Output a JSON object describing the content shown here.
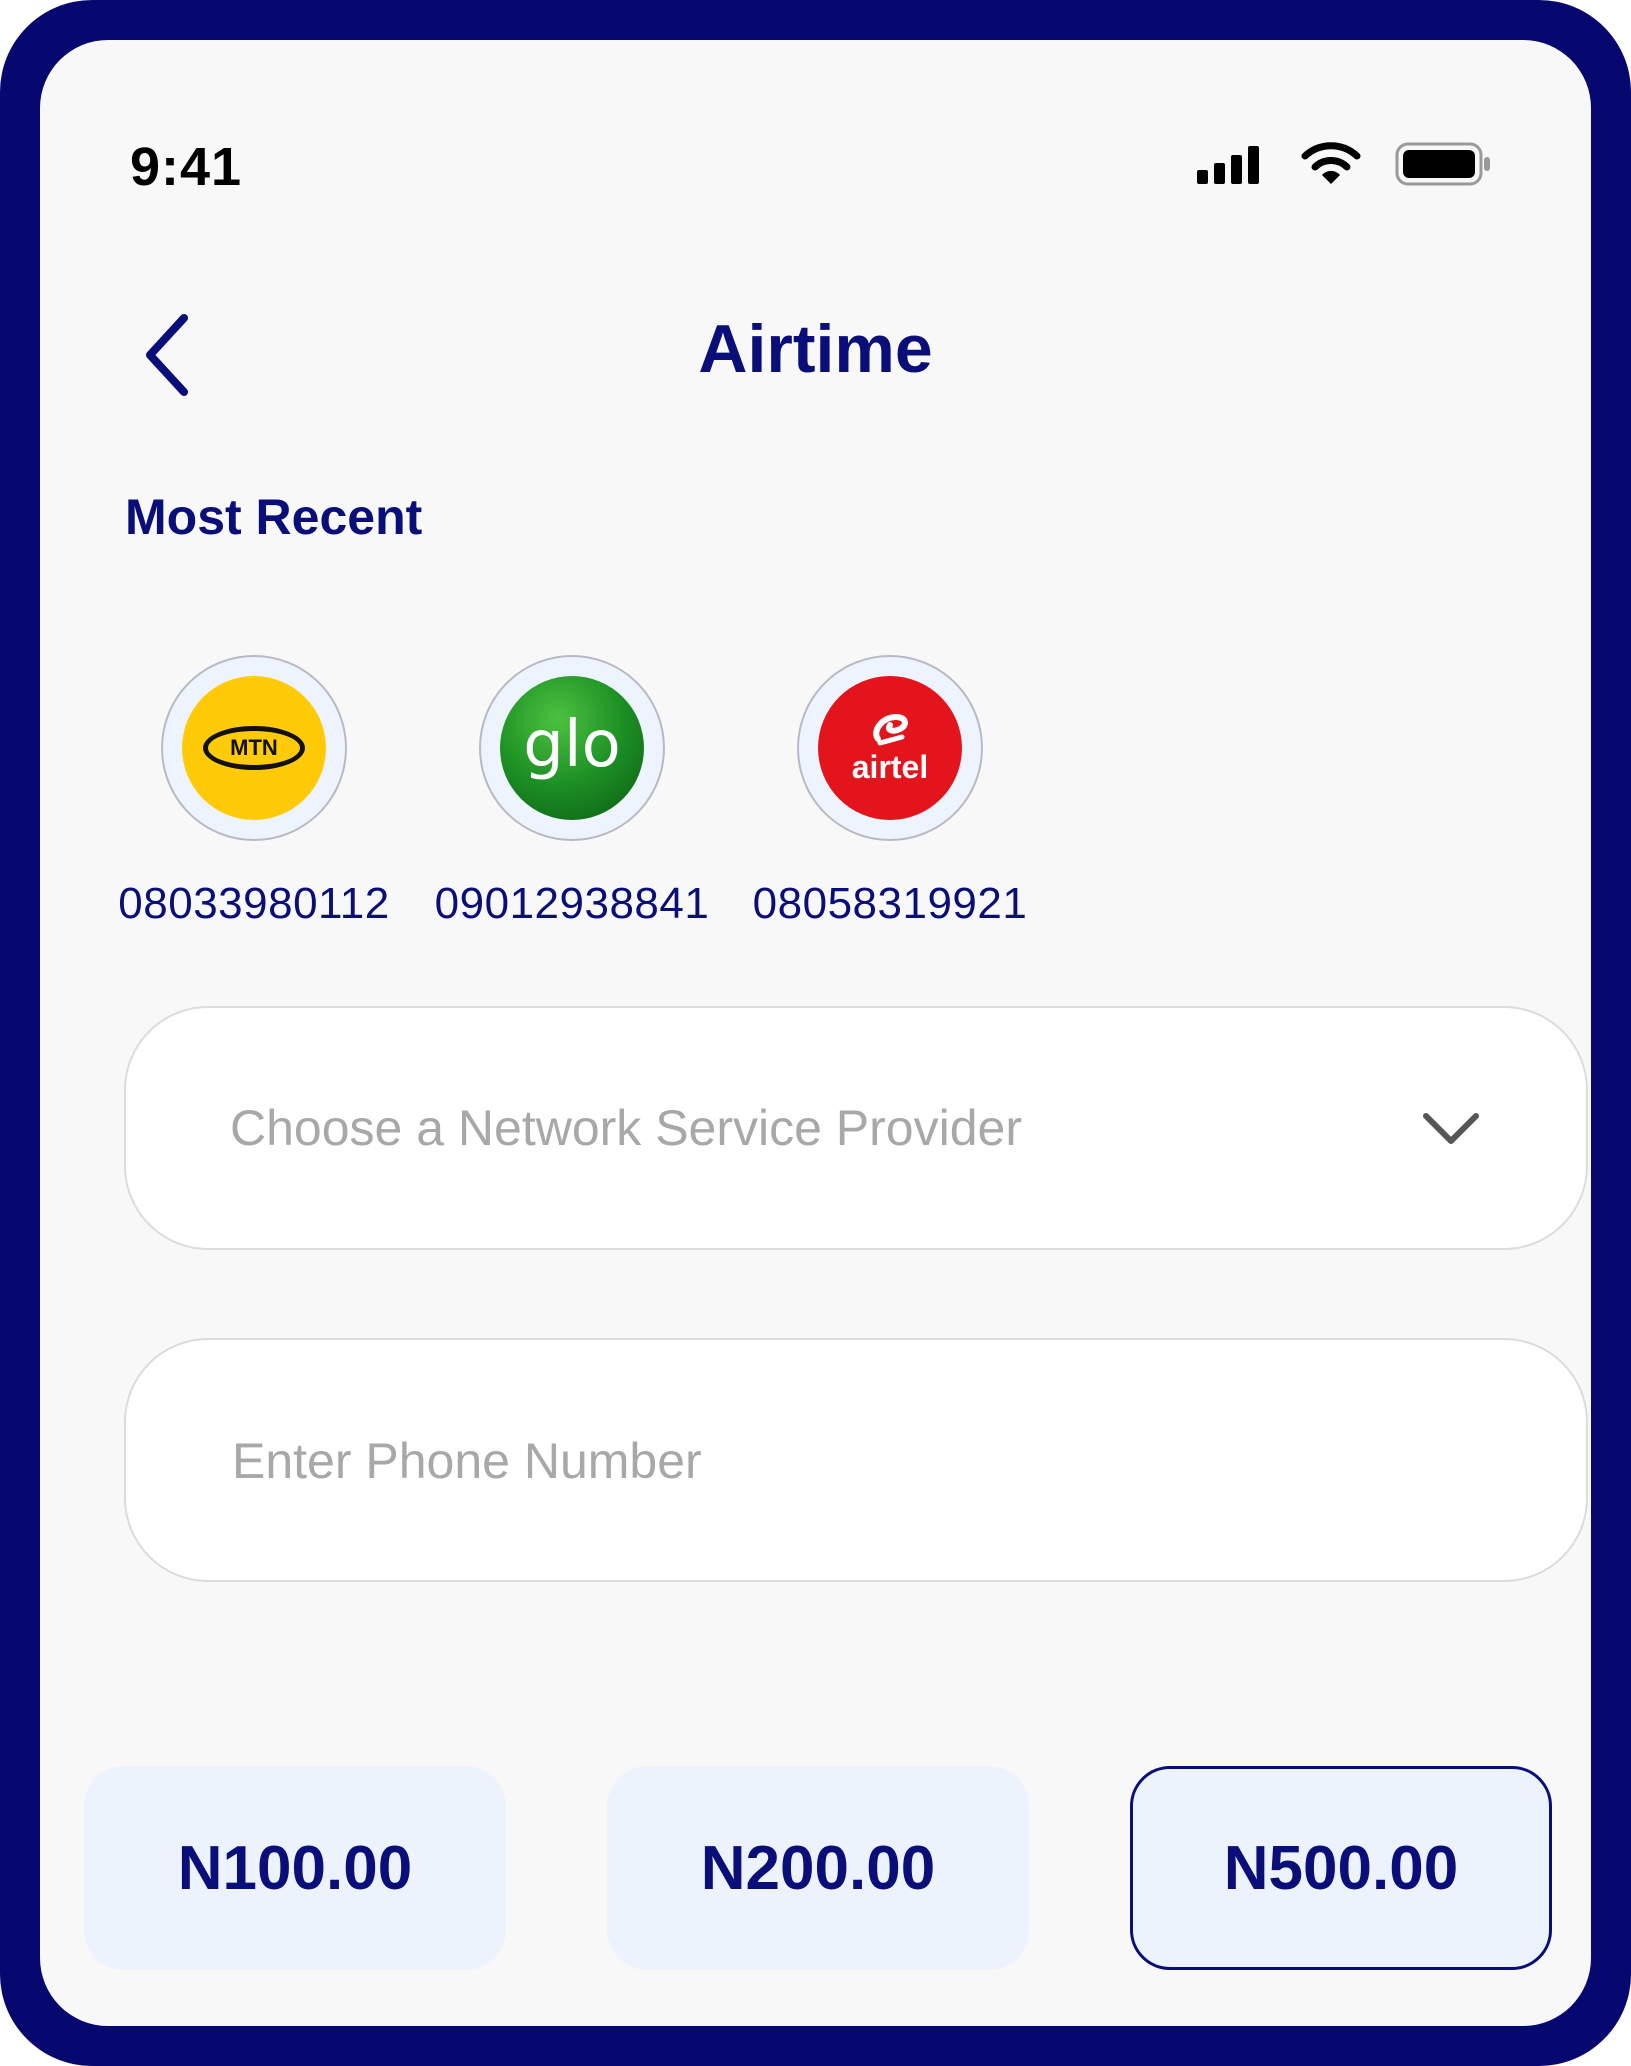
{
  "status_bar": {
    "time": "9:41",
    "icons": [
      "signal-icon",
      "wifi-icon",
      "battery-icon"
    ]
  },
  "header": {
    "title": "Airtime",
    "back_icon": "chevron-left-icon"
  },
  "recent": {
    "title": "Most Recent",
    "items": [
      {
        "network": "MTN",
        "logo_text": "MTN",
        "number": "08033980112"
      },
      {
        "network": "glo",
        "logo_text": "glo",
        "number": "09012938841"
      },
      {
        "network": "airtel",
        "logo_text": "airtel",
        "number": "08058319921"
      }
    ]
  },
  "form": {
    "provider_placeholder": "Choose a Network Service Provider",
    "phone_placeholder": "Enter Phone Number"
  },
  "amounts": [
    {
      "label": "N100.00",
      "selected": false
    },
    {
      "label": "N200.00",
      "selected": false
    },
    {
      "label": "N500.00",
      "selected": true
    }
  ],
  "colors": {
    "frame": "#060870",
    "primary": "#0a0e78",
    "placeholder": "#a8a8a8",
    "chip_bg": "#edf3fd",
    "mtn": "#ffcb08",
    "glo": "#1c8f24",
    "airtel": "#e3141b"
  }
}
